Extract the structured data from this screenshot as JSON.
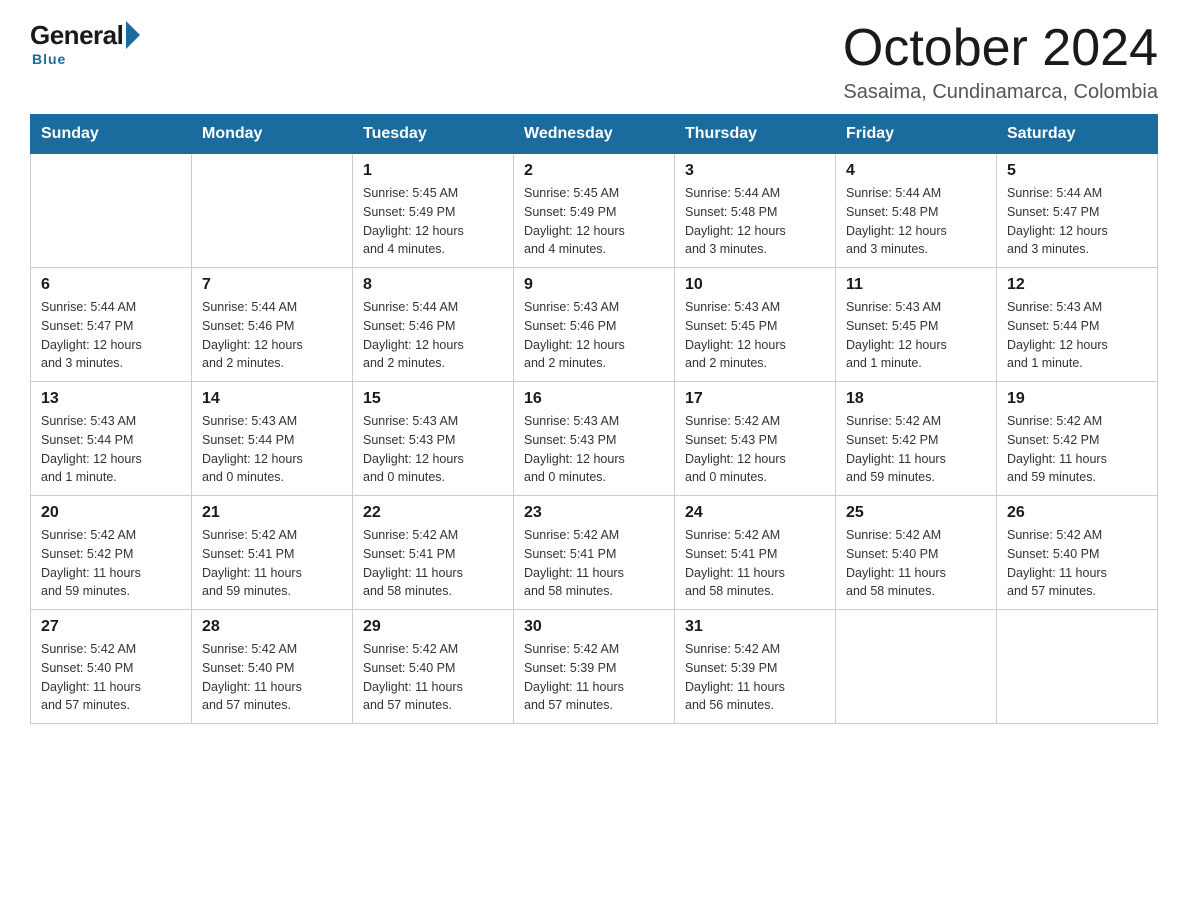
{
  "logo": {
    "general": "General",
    "blue": "Blue",
    "tagline": "Blue"
  },
  "title": "October 2024",
  "location": "Sasaima, Cundinamarca, Colombia",
  "weekdays": [
    "Sunday",
    "Monday",
    "Tuesday",
    "Wednesday",
    "Thursday",
    "Friday",
    "Saturday"
  ],
  "weeks": [
    [
      {
        "day": "",
        "info": ""
      },
      {
        "day": "",
        "info": ""
      },
      {
        "day": "1",
        "info": "Sunrise: 5:45 AM\nSunset: 5:49 PM\nDaylight: 12 hours\nand 4 minutes."
      },
      {
        "day": "2",
        "info": "Sunrise: 5:45 AM\nSunset: 5:49 PM\nDaylight: 12 hours\nand 4 minutes."
      },
      {
        "day": "3",
        "info": "Sunrise: 5:44 AM\nSunset: 5:48 PM\nDaylight: 12 hours\nand 3 minutes."
      },
      {
        "day": "4",
        "info": "Sunrise: 5:44 AM\nSunset: 5:48 PM\nDaylight: 12 hours\nand 3 minutes."
      },
      {
        "day": "5",
        "info": "Sunrise: 5:44 AM\nSunset: 5:47 PM\nDaylight: 12 hours\nand 3 minutes."
      }
    ],
    [
      {
        "day": "6",
        "info": "Sunrise: 5:44 AM\nSunset: 5:47 PM\nDaylight: 12 hours\nand 3 minutes."
      },
      {
        "day": "7",
        "info": "Sunrise: 5:44 AM\nSunset: 5:46 PM\nDaylight: 12 hours\nand 2 minutes."
      },
      {
        "day": "8",
        "info": "Sunrise: 5:44 AM\nSunset: 5:46 PM\nDaylight: 12 hours\nand 2 minutes."
      },
      {
        "day": "9",
        "info": "Sunrise: 5:43 AM\nSunset: 5:46 PM\nDaylight: 12 hours\nand 2 minutes."
      },
      {
        "day": "10",
        "info": "Sunrise: 5:43 AM\nSunset: 5:45 PM\nDaylight: 12 hours\nand 2 minutes."
      },
      {
        "day": "11",
        "info": "Sunrise: 5:43 AM\nSunset: 5:45 PM\nDaylight: 12 hours\nand 1 minute."
      },
      {
        "day": "12",
        "info": "Sunrise: 5:43 AM\nSunset: 5:44 PM\nDaylight: 12 hours\nand 1 minute."
      }
    ],
    [
      {
        "day": "13",
        "info": "Sunrise: 5:43 AM\nSunset: 5:44 PM\nDaylight: 12 hours\nand 1 minute."
      },
      {
        "day": "14",
        "info": "Sunrise: 5:43 AM\nSunset: 5:44 PM\nDaylight: 12 hours\nand 0 minutes."
      },
      {
        "day": "15",
        "info": "Sunrise: 5:43 AM\nSunset: 5:43 PM\nDaylight: 12 hours\nand 0 minutes."
      },
      {
        "day": "16",
        "info": "Sunrise: 5:43 AM\nSunset: 5:43 PM\nDaylight: 12 hours\nand 0 minutes."
      },
      {
        "day": "17",
        "info": "Sunrise: 5:42 AM\nSunset: 5:43 PM\nDaylight: 12 hours\nand 0 minutes."
      },
      {
        "day": "18",
        "info": "Sunrise: 5:42 AM\nSunset: 5:42 PM\nDaylight: 11 hours\nand 59 minutes."
      },
      {
        "day": "19",
        "info": "Sunrise: 5:42 AM\nSunset: 5:42 PM\nDaylight: 11 hours\nand 59 minutes."
      }
    ],
    [
      {
        "day": "20",
        "info": "Sunrise: 5:42 AM\nSunset: 5:42 PM\nDaylight: 11 hours\nand 59 minutes."
      },
      {
        "day": "21",
        "info": "Sunrise: 5:42 AM\nSunset: 5:41 PM\nDaylight: 11 hours\nand 59 minutes."
      },
      {
        "day": "22",
        "info": "Sunrise: 5:42 AM\nSunset: 5:41 PM\nDaylight: 11 hours\nand 58 minutes."
      },
      {
        "day": "23",
        "info": "Sunrise: 5:42 AM\nSunset: 5:41 PM\nDaylight: 11 hours\nand 58 minutes."
      },
      {
        "day": "24",
        "info": "Sunrise: 5:42 AM\nSunset: 5:41 PM\nDaylight: 11 hours\nand 58 minutes."
      },
      {
        "day": "25",
        "info": "Sunrise: 5:42 AM\nSunset: 5:40 PM\nDaylight: 11 hours\nand 58 minutes."
      },
      {
        "day": "26",
        "info": "Sunrise: 5:42 AM\nSunset: 5:40 PM\nDaylight: 11 hours\nand 57 minutes."
      }
    ],
    [
      {
        "day": "27",
        "info": "Sunrise: 5:42 AM\nSunset: 5:40 PM\nDaylight: 11 hours\nand 57 minutes."
      },
      {
        "day": "28",
        "info": "Sunrise: 5:42 AM\nSunset: 5:40 PM\nDaylight: 11 hours\nand 57 minutes."
      },
      {
        "day": "29",
        "info": "Sunrise: 5:42 AM\nSunset: 5:40 PM\nDaylight: 11 hours\nand 57 minutes."
      },
      {
        "day": "30",
        "info": "Sunrise: 5:42 AM\nSunset: 5:39 PM\nDaylight: 11 hours\nand 57 minutes."
      },
      {
        "day": "31",
        "info": "Sunrise: 5:42 AM\nSunset: 5:39 PM\nDaylight: 11 hours\nand 56 minutes."
      },
      {
        "day": "",
        "info": ""
      },
      {
        "day": "",
        "info": ""
      }
    ]
  ]
}
